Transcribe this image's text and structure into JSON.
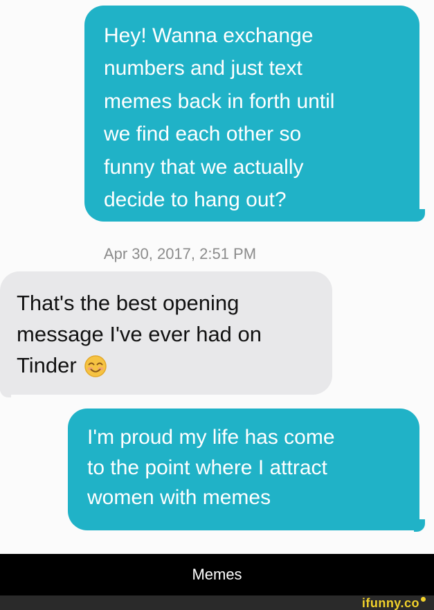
{
  "conversation": {
    "messages": [
      {
        "sender": "outgoing",
        "text": "Hey! Wanna exchange\nnumbers and just text\nmemes back in forth until\nwe find each other so\nfunny that we actually\ndecide to hang out?"
      },
      {
        "sender": "incoming",
        "text": "That's the best opening\nmessage I've ever had on\nTinder",
        "emoji": "smiling-face-with-smiling-eyes-icon"
      },
      {
        "sender": "outgoing",
        "text": "I'm proud my life has come\nto the point where I attract\nwomen with memes"
      }
    ],
    "timestamp": "Apr 30, 2017, 2:51 PM"
  },
  "caption": {
    "text": "Memes"
  },
  "watermark": {
    "text": "ifunny.co"
  },
  "colors": {
    "outgoing_bubble": "#20b2c7",
    "incoming_bubble": "#e8e8ea",
    "watermark": "#f2d22b"
  }
}
